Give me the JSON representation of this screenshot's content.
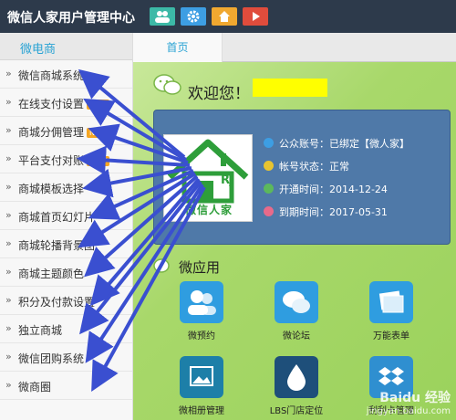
{
  "header": {
    "app_title": "微信人家用户管理中心",
    "buttons": [
      {
        "name": "users",
        "color": "#3cb9a7",
        "icon": "users-icon"
      },
      {
        "name": "settings",
        "color": "#3d9ee3",
        "icon": "gear-icon"
      },
      {
        "name": "home",
        "color": "#f0a830",
        "icon": "home-icon"
      },
      {
        "name": "play",
        "color": "#e04c3c",
        "icon": "play-icon"
      }
    ]
  },
  "sidebar": {
    "header": "微电商",
    "items": [
      {
        "label": "微信商城系统",
        "badge": ""
      },
      {
        "label": "在线支付设置",
        "badge": "NEW"
      },
      {
        "label": "商城分佣管理",
        "badge": "NEW"
      },
      {
        "label": "平台支付对账",
        "badge": "NEW"
      },
      {
        "label": "商城模板选择",
        "badge": ""
      },
      {
        "label": "商城首页幻灯片",
        "badge": ""
      },
      {
        "label": "商城轮播背景图",
        "badge": ""
      },
      {
        "label": "商城主题颜色",
        "badge": ""
      },
      {
        "label": "积分及付款设置",
        "badge": ""
      },
      {
        "label": "独立商城",
        "badge": ""
      },
      {
        "label": "微信团购系统",
        "badge": ""
      },
      {
        "label": "微商圈",
        "badge": ""
      }
    ]
  },
  "tabs": {
    "home": "首页"
  },
  "welcome": {
    "text": "欢迎您！",
    "name_highlight_color": "#ffff00"
  },
  "info": {
    "logo_initials": "RJ",
    "logo_text": "微信人家",
    "rows": [
      {
        "label": "公众账号：已绑定【微人家】",
        "icon": "flag-icon",
        "color": "#3d9ee3"
      },
      {
        "label": "帐号状态：正常",
        "icon": "alert-icon",
        "color": "#e8c430"
      },
      {
        "label": "开通时间：2014-12-24",
        "icon": "check-icon",
        "color": "#5cb85c"
      },
      {
        "label": "到期时间：2017-05-31",
        "icon": "clock-icon",
        "color": "#e86a8a"
      }
    ]
  },
  "apps": {
    "title": "微应用",
    "items": [
      {
        "label": "微预约",
        "icon": "people-icon",
        "color": "#2f9de0"
      },
      {
        "label": "微论坛",
        "icon": "chat-icon",
        "color": "#2f9de0"
      },
      {
        "label": "万能表单",
        "icon": "form-icon",
        "color": "#2f9de0"
      },
      {
        "label": "微相册管理",
        "icon": "album-icon",
        "color": "#1d7fa8"
      },
      {
        "label": "LBS门店定位",
        "icon": "drop-icon",
        "color": "#2f8fd0"
      },
      {
        "label": "刮刮卡管理",
        "icon": "dropbox-icon",
        "color": "#2f8fd0"
      }
    ]
  },
  "watermark": {
    "main": "Baidu 经验",
    "sub": "jingyan.baidu.com"
  },
  "arrow_color": "#3a4fd0"
}
